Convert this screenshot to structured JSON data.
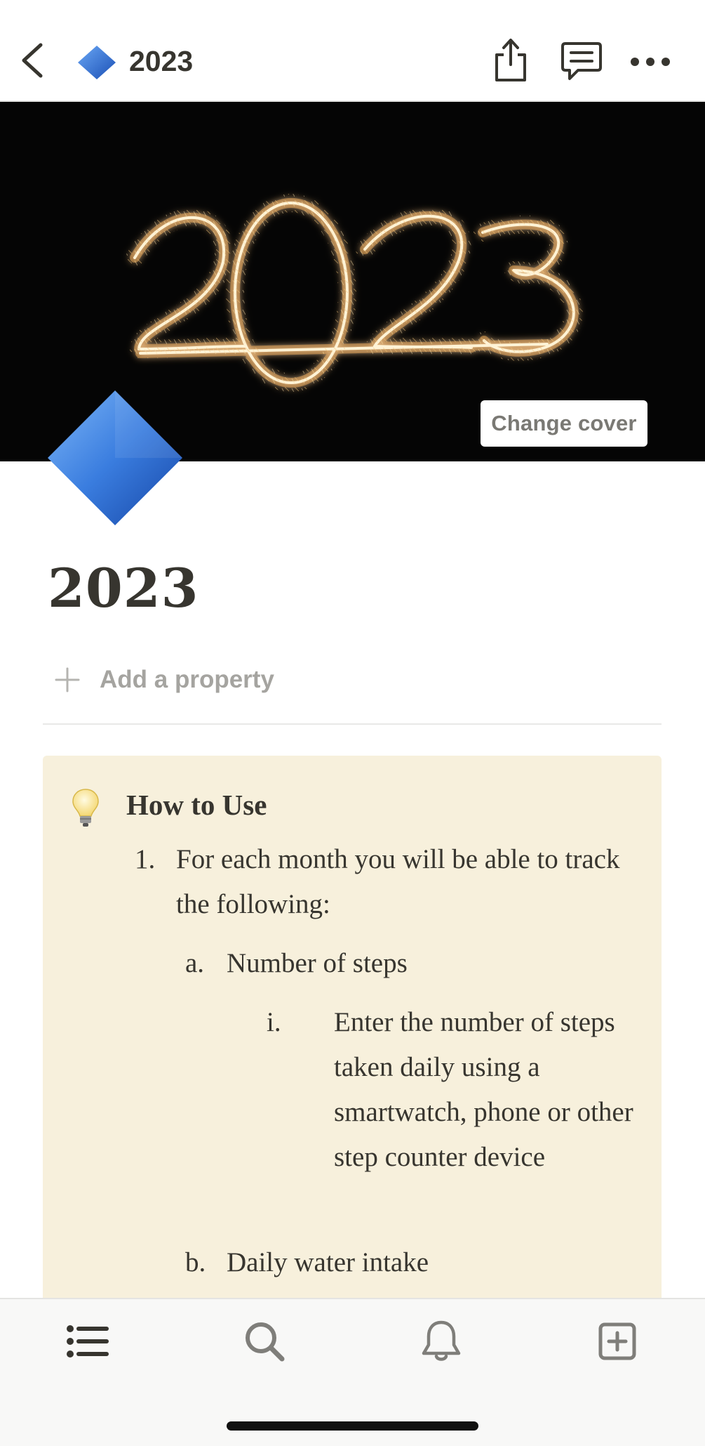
{
  "nav": {
    "title": "2023",
    "icons": [
      "back-chevron-icon",
      "blue-diamond-icon",
      "share-icon",
      "comment-icon",
      "more-icon"
    ]
  },
  "cover": {
    "button_label": "Change cover",
    "image_description_icon": "sparkler-2023-image"
  },
  "page": {
    "title": "2023",
    "add_property_label": "Add a property"
  },
  "callout": {
    "icon": "lightbulb-icon",
    "background_color": "#f7f0dc",
    "title": "How to Use",
    "items": [
      {
        "marker": "1.",
        "text": "For each month you will be able to track the following:",
        "children": [
          {
            "marker": "a.",
            "text": "Number of steps",
            "children": [
              {
                "marker": "i.",
                "text": "Enter the number of steps taken daily using a smartwatch, phone or other step counter device"
              }
            ]
          },
          {
            "marker": "b.",
            "text": "Daily water intake"
          }
        ]
      }
    ]
  },
  "tabbar": {
    "tabs": [
      "list-icon",
      "search-icon",
      "bell-icon",
      "new-page-icon"
    ]
  },
  "colors": {
    "text": "#37352f",
    "muted": "#a5a4a0",
    "diamond_blue": "#2f6fd6"
  }
}
